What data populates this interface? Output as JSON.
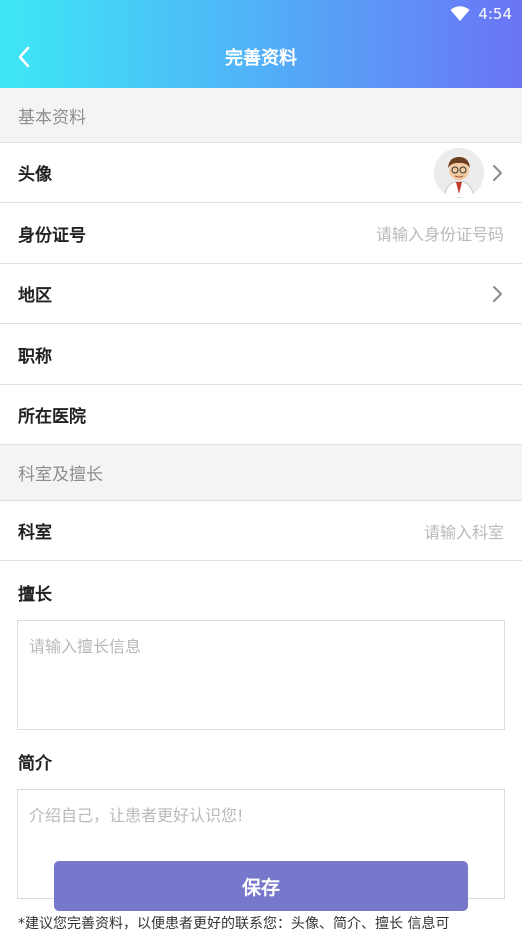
{
  "status_bar": {
    "time": "4:54"
  },
  "header": {
    "title": "完善资料"
  },
  "sections": {
    "basic": "基本资料",
    "department": "科室及擅长"
  },
  "rows": {
    "avatar": {
      "label": "头像"
    },
    "id_number": {
      "label": "身份证号",
      "placeholder": "请输入身份证号码"
    },
    "region": {
      "label": "地区"
    },
    "title": {
      "label": "职称"
    },
    "hospital": {
      "label": "所在医院"
    },
    "department": {
      "label": "科室",
      "placeholder": "请输入科室"
    }
  },
  "specialty": {
    "label": "擅长",
    "placeholder": "请输入擅长信息"
  },
  "intro": {
    "label": "简介",
    "placeholder": "介绍自己，让患者更好认识您!"
  },
  "save_button": "保存",
  "footer_note": "*建议您完善资料，以便患者更好的联系您：头像、简介、擅长 信息可",
  "colors": {
    "accent": "#7778cc",
    "header_start": "#3de8f6",
    "header_end": "#6a74f6"
  }
}
